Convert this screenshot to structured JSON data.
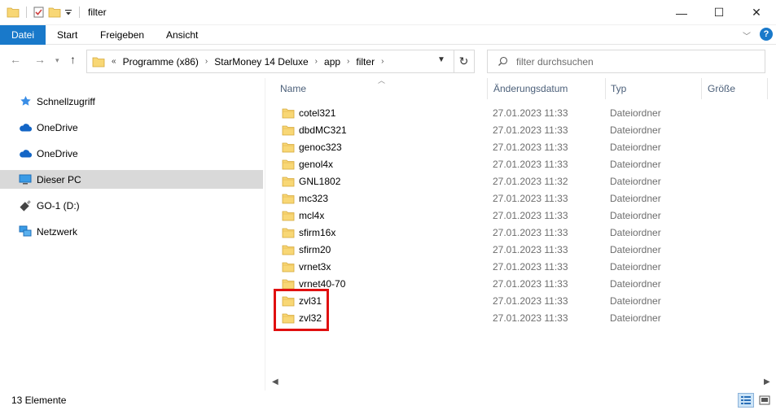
{
  "window": {
    "title": "filter",
    "minimize": "—",
    "maximize": "☐",
    "close": "✕"
  },
  "ribbon": {
    "tabs": [
      "Datei",
      "Start",
      "Freigeben",
      "Ansicht"
    ],
    "help": "?"
  },
  "address": {
    "crumbs": [
      "Programme (x86)",
      "StarMoney 14 Deluxe",
      "app",
      "filter"
    ],
    "overflow": "«"
  },
  "search": {
    "placeholder": "filter durchsuchen"
  },
  "sidebar": {
    "items": [
      {
        "label": "Schnellzugriff",
        "icon": "star-icon"
      },
      {
        "label": "OneDrive",
        "icon": "cloud-icon"
      },
      {
        "label": "OneDrive",
        "icon": "cloud-icon"
      },
      {
        "label": "Dieser PC",
        "icon": "computer-icon",
        "selected": true
      },
      {
        "label": "GO-1 (D:)",
        "icon": "usb-drive-icon"
      },
      {
        "label": "Netzwerk",
        "icon": "network-icon"
      }
    ]
  },
  "columns": {
    "name": "Name",
    "date": "Änderungsdatum",
    "type": "Typ",
    "size": "Größe"
  },
  "files": [
    {
      "name": "cotel321",
      "date": "27.01.2023 11:33",
      "type": "Dateiordner"
    },
    {
      "name": "dbdMC321",
      "date": "27.01.2023 11:33",
      "type": "Dateiordner"
    },
    {
      "name": "genoc323",
      "date": "27.01.2023 11:33",
      "type": "Dateiordner"
    },
    {
      "name": "genol4x",
      "date": "27.01.2023 11:33",
      "type": "Dateiordner"
    },
    {
      "name": "GNL1802",
      "date": "27.01.2023 11:32",
      "type": "Dateiordner"
    },
    {
      "name": "mc323",
      "date": "27.01.2023 11:33",
      "type": "Dateiordner"
    },
    {
      "name": "mcl4x",
      "date": "27.01.2023 11:33",
      "type": "Dateiordner"
    },
    {
      "name": "sfirm16x",
      "date": "27.01.2023 11:33",
      "type": "Dateiordner"
    },
    {
      "name": "sfirm20",
      "date": "27.01.2023 11:33",
      "type": "Dateiordner"
    },
    {
      "name": "vrnet3x",
      "date": "27.01.2023 11:33",
      "type": "Dateiordner"
    },
    {
      "name": "vrnet40-70",
      "date": "27.01.2023 11:33",
      "type": "Dateiordner"
    },
    {
      "name": "zvl31",
      "date": "27.01.2023 11:33",
      "type": "Dateiordner"
    },
    {
      "name": "zvl32",
      "date": "27.01.2023 11:33",
      "type": "Dateiordner"
    }
  ],
  "status": {
    "count": "13 Elemente"
  },
  "colors": {
    "accent": "#1979ca",
    "folder": "#f8d775",
    "highlight": "#e01010"
  }
}
